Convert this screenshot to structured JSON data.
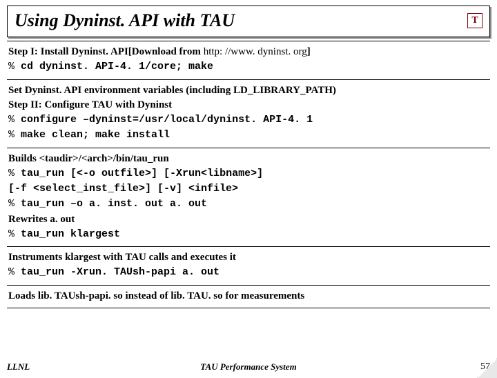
{
  "title": "Using Dyninst. API with TAU",
  "logo_letter": "T",
  "blocks": [
    {
      "lines": [
        {
          "segments": [
            {
              "t": "Step I: Install Dyninst. API[Download from ",
              "cls": "bold"
            },
            {
              "t": "http: //www. dyninst. org",
              "cls": "link"
            },
            {
              "t": "]",
              "cls": "bold"
            }
          ]
        },
        {
          "segments": [
            {
              "t": "% ",
              "cls": "prompt"
            },
            {
              "t": "cd dyninst. API-4. 1/core; make",
              "cls": "mono"
            }
          ]
        }
      ]
    },
    {
      "lines": [
        {
          "segments": [
            {
              "t": "Set Dyninst. API environment variables (including LD_LIBRARY_PATH)",
              "cls": "bold"
            }
          ]
        },
        {
          "segments": [
            {
              "t": "Step II: Configure TAU with Dyninst",
              "cls": "bold"
            }
          ]
        },
        {
          "segments": [
            {
              "t": "% ",
              "cls": "prompt"
            },
            {
              "t": "configure –dyninst=/usr/local/dyninst. API-4. 1",
              "cls": "mono"
            }
          ]
        },
        {
          "segments": [
            {
              "t": "% ",
              "cls": "prompt"
            },
            {
              "t": "make clean; make install",
              "cls": "mono"
            }
          ]
        }
      ]
    },
    {
      "lines": [
        {
          "segments": [
            {
              "t": "Builds <taudir>/<arch>/bin/tau_run",
              "cls": "bold"
            }
          ]
        },
        {
          "segments": [
            {
              "t": "% ",
              "cls": "prompt"
            },
            {
              "t": "tau_run [<-o outfile>] [-Xrun<libname>]",
              "cls": "mono"
            }
          ]
        },
        {
          "segments": [
            {
              "t": "  [-f <select_inst_file>] [-v] <infile>",
              "cls": "mono"
            }
          ]
        },
        {
          "segments": [
            {
              "t": "% ",
              "cls": "prompt"
            },
            {
              "t": "tau_run –o a. inst. out a. out",
              "cls": "mono"
            }
          ]
        },
        {
          "segments": [
            {
              "t": "Rewrites a. out",
              "cls": "bold"
            }
          ]
        },
        {
          "segments": [
            {
              "t": "% ",
              "cls": "prompt"
            },
            {
              "t": "tau_run klargest",
              "cls": "mono"
            }
          ]
        }
      ]
    },
    {
      "lines": [
        {
          "segments": [
            {
              "t": "Instruments klargest with TAU calls and executes it",
              "cls": "bold"
            }
          ]
        },
        {
          "segments": [
            {
              "t": "% ",
              "cls": "prompt"
            },
            {
              "t": "tau_run -Xrun. TAUsh-papi a. out",
              "cls": "mono"
            }
          ]
        }
      ]
    },
    {
      "lines": [
        {
          "segments": [
            {
              "t": "Loads lib. TAUsh-papi. so instead of lib. TAU. so for measurements",
              "cls": "bold"
            }
          ]
        }
      ]
    }
  ],
  "footer": {
    "left": "LLNL",
    "center": "TAU Performance System",
    "right": "57"
  }
}
